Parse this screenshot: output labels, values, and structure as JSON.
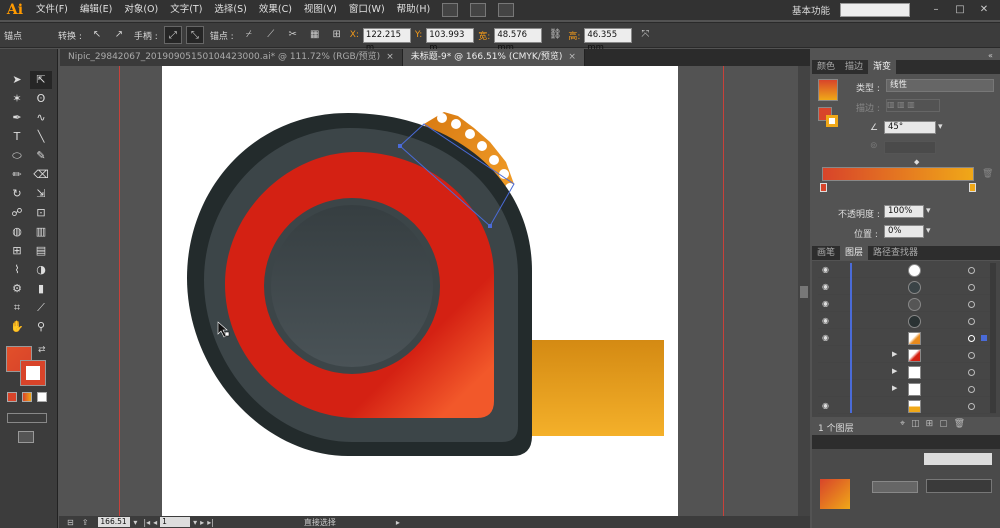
{
  "menubar": {
    "logo": "Ai",
    "items": [
      "文件(F)",
      "编辑(E)",
      "对象(O)",
      "文字(T)",
      "选择(S)",
      "效果(C)",
      "视图(V)",
      "窗口(W)",
      "帮助(H)"
    ],
    "workspace": "基本功能"
  },
  "controlbar": {
    "anchor_label": "锚点",
    "convert_label": "转换 :",
    "handle_label": "手柄 :",
    "anchor_point_label": "锚点 :",
    "x_key": "X:",
    "x_value": "122.215 m",
    "y_key": "Y:",
    "y_value": "103.993 m",
    "w_key": "宽:",
    "w_value": "48.576 mm",
    "h_key": "高:",
    "h_value": "46.355 mm"
  },
  "tabs": [
    {
      "label": "Nipic_29842067_20190905150104423000.ai* @ 111.72% (RGB/预览)",
      "close": "×"
    },
    {
      "label": "未标题-9* @ 166.51% (CMYK/预览)",
      "close": "×"
    }
  ],
  "status": {
    "zoom": "166.51",
    "page": "1",
    "tool": "直接选择"
  },
  "gradient_panel": {
    "tabs": [
      "颜色",
      "描边",
      "渐变"
    ],
    "type_label": "类型 :",
    "type_value": "线性",
    "stroke_label": "描边 :",
    "angle_value": "45°",
    "opacity_label": "不透明度 :",
    "opacity_value": "100%",
    "position_label": "位置 :",
    "position_value": "0%",
    "start_color": "#d8442a",
    "end_color": "#f0a818"
  },
  "layers_panel": {
    "tabs": [
      "画笔",
      "图层",
      "路径查找器"
    ],
    "footer_label": "1 个图层"
  },
  "artwork": {
    "body_outer": "#232b2c",
    "body_ring": "#3c4548",
    "red_face": "#d42113",
    "red_face_light": "#f2582a",
    "hub_dark": "#363e41",
    "hub_light": "#4a5357",
    "tape_top": "#d48a13",
    "tape_bottom": "#f4b02a",
    "gear_color": "#e88a1c"
  }
}
